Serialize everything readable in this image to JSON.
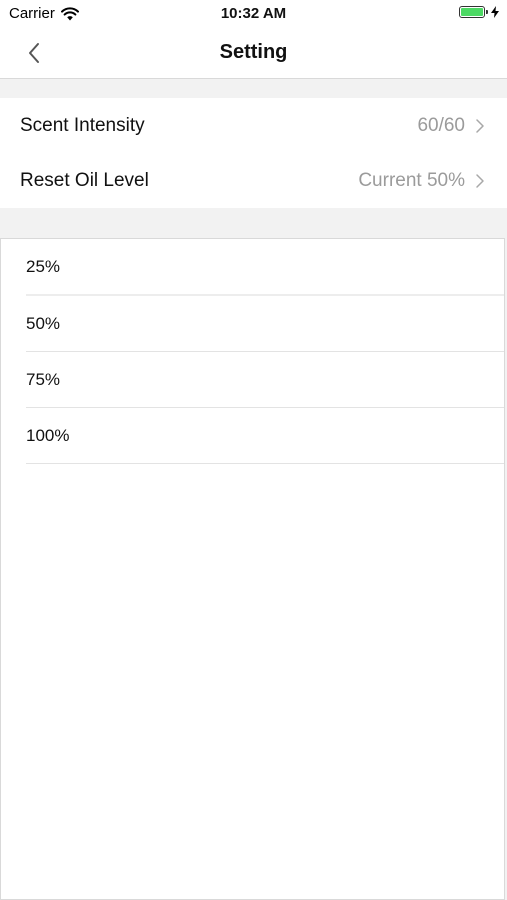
{
  "status_bar": {
    "carrier": "Carrier",
    "time": "10:32 AM",
    "wifi_icon": "wifi-icon",
    "battery_icon": "battery-icon",
    "charging_icon": "bolt-icon",
    "battery_color": "#4cd964"
  },
  "nav": {
    "title": "Setting",
    "back_icon": "chevron-left-icon"
  },
  "settings": [
    {
      "label": "Scent Intensity",
      "value": "60/60"
    },
    {
      "label": "Reset Oil Level",
      "value": "Current 50%"
    }
  ],
  "oil_level_options": [
    {
      "label": "25%"
    },
    {
      "label": "50%"
    },
    {
      "label": "75%"
    },
    {
      "label": "100%"
    }
  ]
}
